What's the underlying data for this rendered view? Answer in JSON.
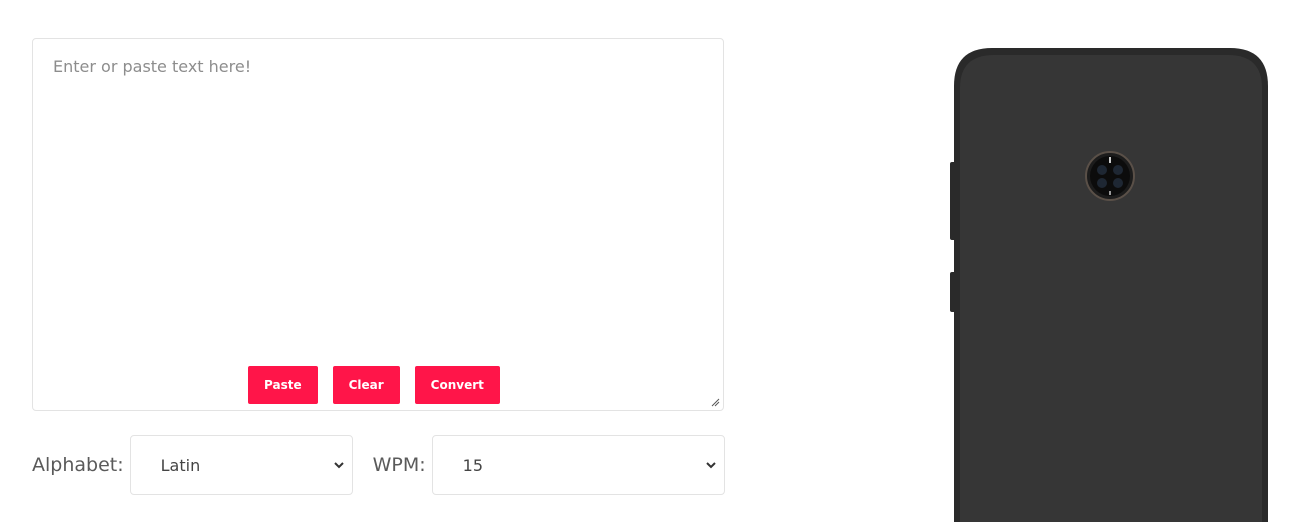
{
  "editor": {
    "placeholder": "Enter or paste text here!",
    "value": ""
  },
  "buttons": {
    "paste": "Paste",
    "clear": "Clear",
    "convert": "Convert"
  },
  "alphabet": {
    "label": "Alphabet:",
    "selected": "Latin"
  },
  "wpm": {
    "label": "WPM:",
    "selected": "15"
  },
  "colors": {
    "accent": "#ff1549",
    "phone_body": "#363636"
  },
  "icons": {
    "select_arrow": "chevron-down-icon",
    "resize": "resize-grip-icon"
  }
}
